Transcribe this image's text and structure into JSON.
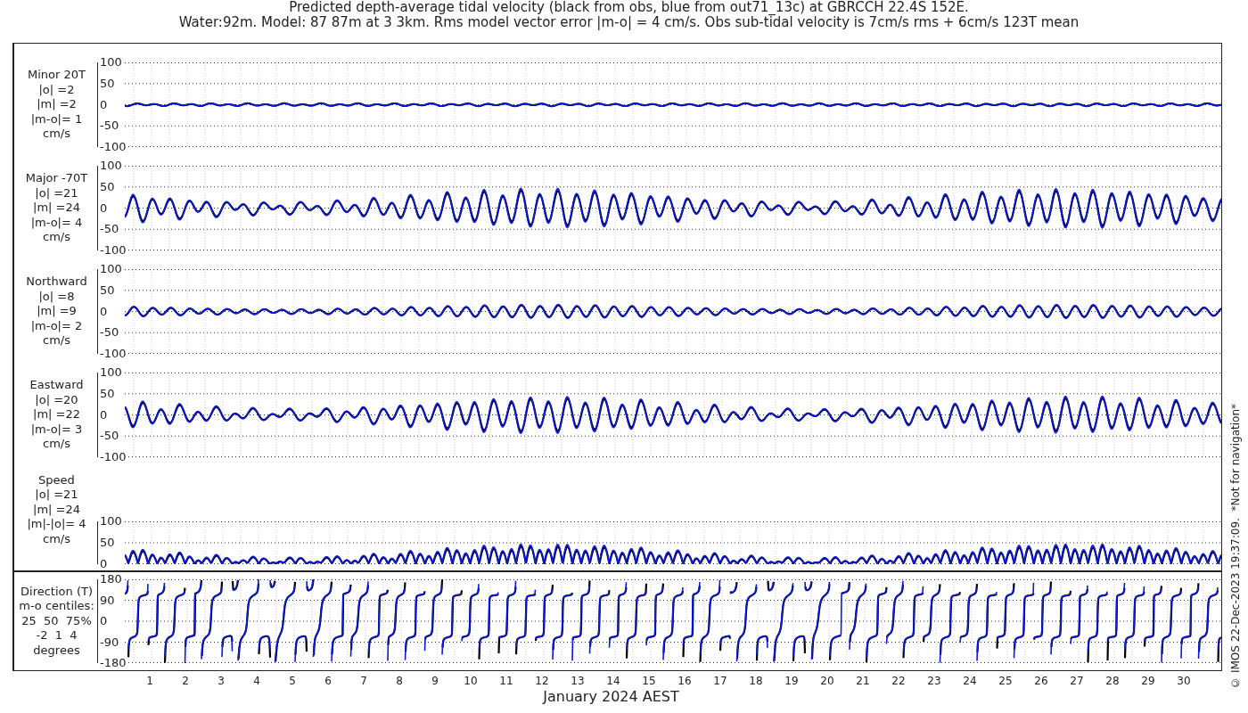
{
  "title": [
    "Predicted depth-average tidal velocity (black from obs, blue from out71_13c) at GBRCCH 22.4S 152E.",
    "Water:92m. Model: 87 87m at 3 3km. Rms model vector error |m-o| = 4 cm/s. Obs sub-tidal velocity is 7cm/s rms + 6cm/s 123T mean"
  ],
  "panels": [
    {
      "kind": "minor",
      "label": [
        "Minor 20T",
        "|o| =2",
        "|m| =2",
        "|m-o|= 1",
        "cm/s"
      ],
      "yticks": [
        "100",
        "50",
        "0",
        "-50",
        "-100"
      ]
    },
    {
      "kind": "major",
      "label": [
        "Major -70T",
        "|o| =21",
        "|m| =24",
        "|m-o|= 4",
        "cm/s"
      ],
      "yticks": [
        "100",
        "50",
        "0",
        "-50",
        "-100"
      ]
    },
    {
      "kind": "north",
      "label": [
        "Northward",
        "|o| =8",
        "|m| =9",
        "|m-o|= 2",
        "cm/s"
      ],
      "yticks": [
        "100",
        "50",
        "0",
        "-50",
        "-100"
      ]
    },
    {
      "kind": "east",
      "label": [
        "Eastward",
        "|o| =20",
        "|m| =22",
        "|m-o|= 3",
        "cm/s"
      ],
      "yticks": [
        "100",
        "50",
        "0",
        "-50",
        "-100"
      ]
    },
    {
      "kind": "speed",
      "label": [
        "Speed",
        "|o| =21",
        "|m| =24",
        "|m|-|o|= 4",
        "cm/s"
      ],
      "yticks": [
        "100",
        "50",
        "0"
      ]
    },
    {
      "kind": "direction",
      "label": [
        "Direction (T)",
        "m-o centiles:",
        "25  50  75%",
        "-2  1  4",
        "degrees"
      ],
      "yticks": [
        "180",
        "90",
        "0",
        "-90",
        "-180"
      ]
    }
  ],
  "x_axis": {
    "ticks": [
      "1",
      "2",
      "3",
      "4",
      "5",
      "6",
      "7",
      "8",
      "9",
      "10",
      "11",
      "12",
      "13",
      "14",
      "15",
      "16",
      "17",
      "18",
      "19",
      "20",
      "21",
      "22",
      "23",
      "24",
      "25",
      "26",
      "27",
      "28",
      "29",
      "30"
    ],
    "label": "January 2024 AEST"
  },
  "credit": "© IMOS 22-Dec-2023 19:37:09.  *Not for navigation*"
}
